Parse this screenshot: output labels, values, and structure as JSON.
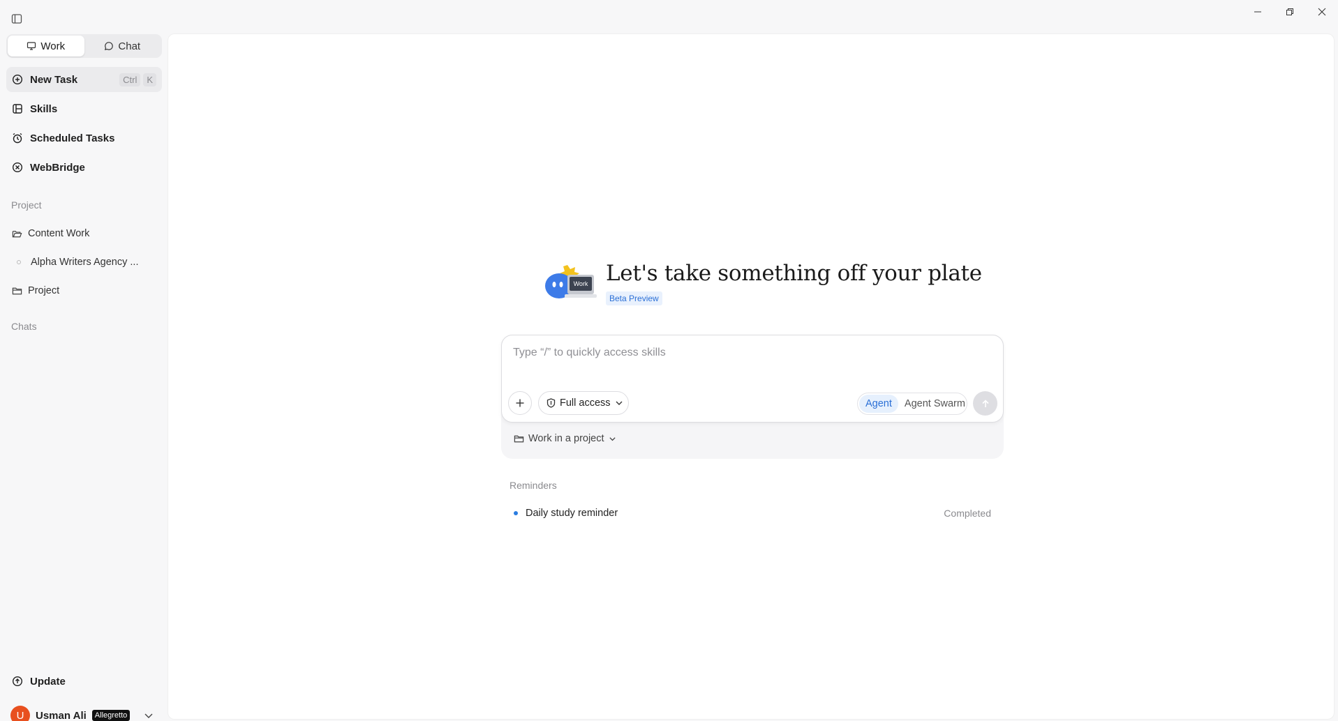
{
  "sidebar": {
    "tabs": [
      {
        "label": "Work",
        "active": true
      },
      {
        "label": "Chat",
        "active": false
      }
    ],
    "nav": [
      {
        "label": "New Task",
        "icon": "plus-circle-icon",
        "shortcut": [
          "Ctrl",
          "K"
        ]
      },
      {
        "label": "Skills",
        "icon": "skills-icon"
      },
      {
        "label": "Scheduled Tasks",
        "icon": "alarm-clock-icon"
      },
      {
        "label": "WebBridge",
        "icon": "webbridge-icon"
      }
    ],
    "project_section": "Project",
    "projects": [
      {
        "label": "Content Work",
        "icon": "folder-open-icon"
      },
      {
        "label": "Alpha Writers Agency ...",
        "icon": "dot-icon"
      },
      {
        "label": "Project",
        "icon": "folder-icon"
      }
    ],
    "chats_section": "Chats",
    "update_label": "Update",
    "user": {
      "initial": "U",
      "name": "Usman Ali",
      "plan": "Allegretto"
    }
  },
  "main": {
    "hero_title": "Let's take something off your plate",
    "beta_label": "Beta Preview",
    "mascot_label": "Work",
    "composer": {
      "placeholder": "Type “/” to quickly access skills",
      "access_label": "Full access",
      "modes": [
        {
          "label": "Agent",
          "active": true
        },
        {
          "label": "Agent Swarm",
          "active": false
        }
      ],
      "project_selector": "Work in a project"
    },
    "reminders": {
      "label": "Reminders",
      "items": [
        {
          "title": "Daily study reminder",
          "status": "Completed"
        }
      ]
    }
  },
  "colors": {
    "accent": "#2a6fd6",
    "avatar": "#e8501f",
    "background": "#f7f7f8"
  }
}
